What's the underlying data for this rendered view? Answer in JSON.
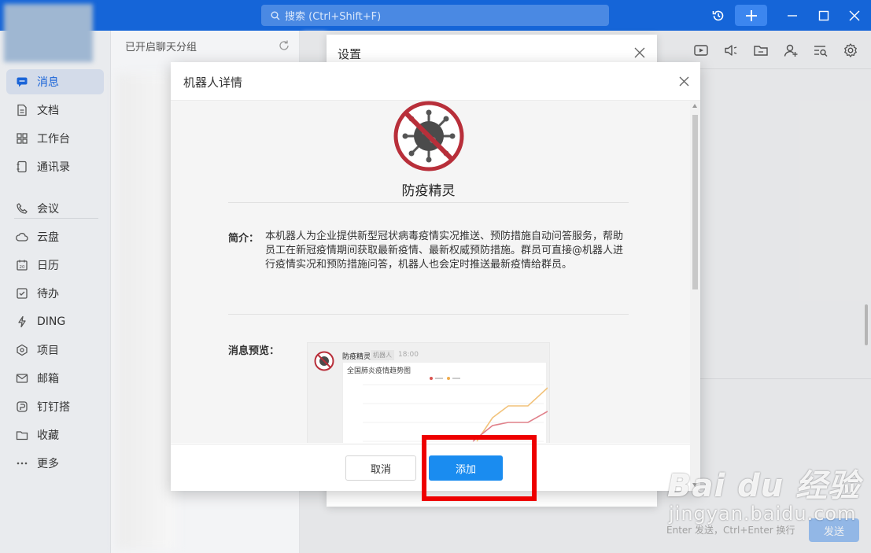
{
  "topbar": {
    "search_placeholder": "搜索 (Ctrl+Shift+F)"
  },
  "sidebar": {
    "items": [
      {
        "label": "消息",
        "icon": "message-icon"
      },
      {
        "label": "文档",
        "icon": "document-icon"
      },
      {
        "label": "工作台",
        "icon": "workbench-icon"
      },
      {
        "label": "通讯录",
        "icon": "contacts-icon"
      },
      {
        "label": "会议",
        "icon": "phone-icon"
      },
      {
        "label": "云盘",
        "icon": "cloud-icon"
      },
      {
        "label": "日历",
        "icon": "calendar-icon"
      },
      {
        "label": "待办",
        "icon": "todo-icon"
      },
      {
        "label": "DING",
        "icon": "lightning-icon"
      },
      {
        "label": "项目",
        "icon": "project-icon"
      },
      {
        "label": "邮箱",
        "icon": "mail-icon"
      },
      {
        "label": "钉钉搭",
        "icon": "build-icon"
      },
      {
        "label": "收藏",
        "icon": "folder-icon"
      },
      {
        "label": "更多",
        "icon": "more-icon"
      }
    ]
  },
  "conversation_list": {
    "header": "已开启聊天分组"
  },
  "settings_dialog": {
    "title": "设置"
  },
  "robot_dialog": {
    "title": "机器人详情",
    "robot_name": "防疫精灵",
    "intro_label": "简介：",
    "intro_text": "本机器人为企业提供新型冠状病毒疫情实况推送、预防措施自动问答服务，帮助员工在新冠疫情期间获取最新疫情、最新权威预防措施。群员可直接@机器人进行疫情实况和预防措施问答，机器人也会定时推送最新疫情给群员。",
    "preview_label": "消息预览：",
    "preview": {
      "sender": "防疫精灵",
      "tag": "机器人",
      "time": "18:00",
      "chart_title": "全国肺炎疫情趋势图"
    },
    "cancel_label": "取消",
    "add_label": "添加"
  },
  "compose": {
    "hint": "Enter 发送，Ctrl+Enter 换行",
    "send_label": "发送"
  },
  "watermark": {
    "brand": "Bai du 经验",
    "site": "jingyan.baidu.com"
  },
  "colors": {
    "titlebar": "#1565d8",
    "primary_button": "#1a8cf0",
    "highlight_box": "#ee0000",
    "active_nav": "#1a64d8"
  }
}
